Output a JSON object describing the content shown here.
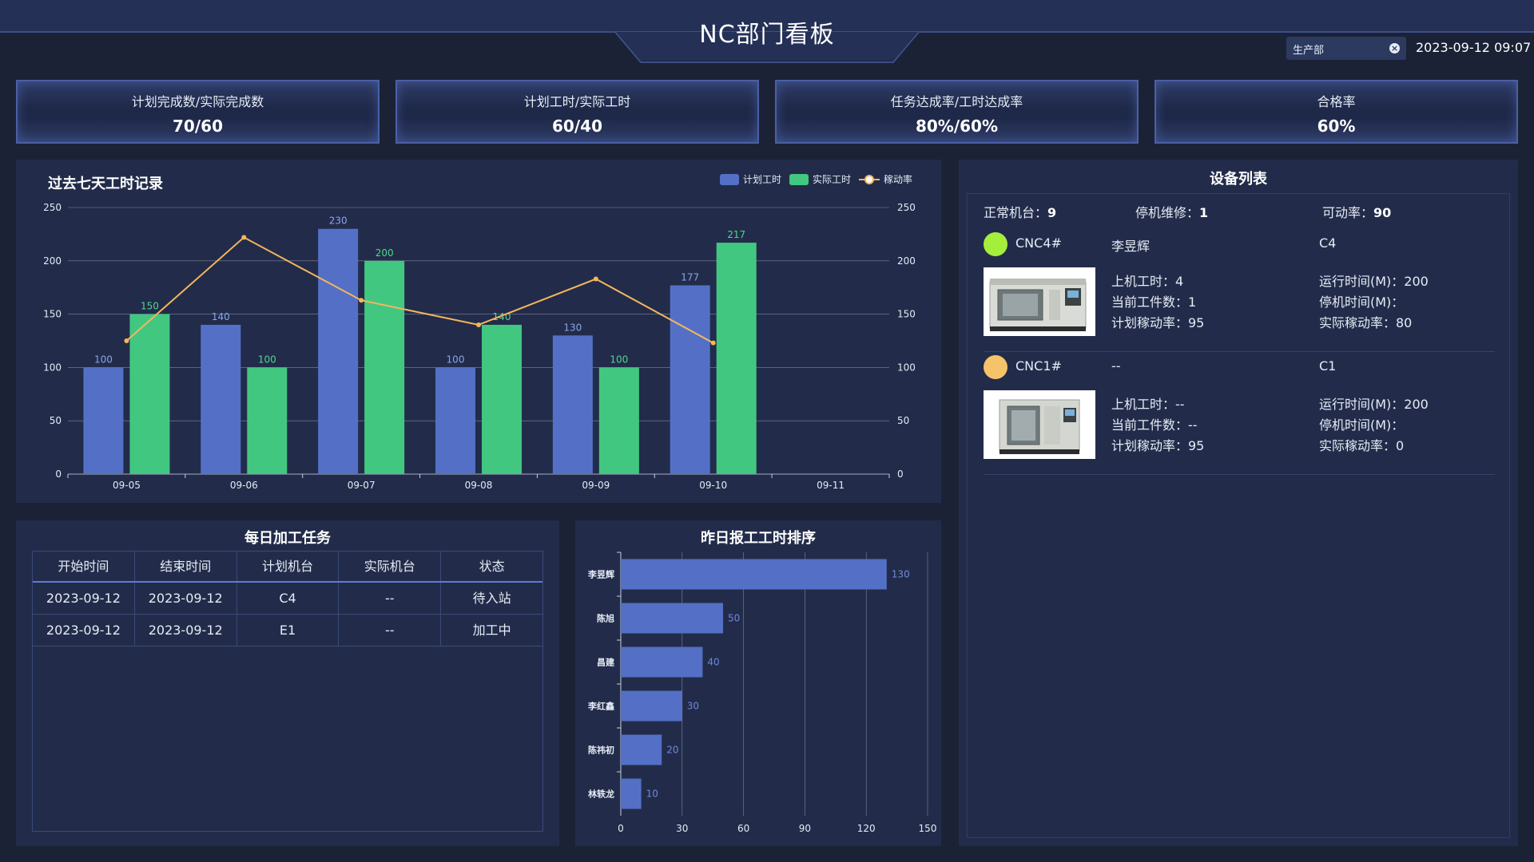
{
  "header": {
    "title": "NC部门看板",
    "department": "生产部",
    "datetime": "2023-09-12 09:07"
  },
  "kpis": [
    {
      "label": "计划完成数/实际完成数",
      "value": "70/60"
    },
    {
      "label": "计划工时/实际工时",
      "value": "60/40"
    },
    {
      "label": "任务达成率/工时达成率",
      "value": "80%/60%"
    },
    {
      "label": "合格率",
      "value": "60%"
    }
  ],
  "work_hours_panel": {
    "title": "过去七天工时记录",
    "legend": {
      "plan": "计划工时",
      "actual": "实际工时",
      "rate": "稼动率"
    }
  },
  "daily_tasks": {
    "title": "每日加工任务",
    "columns": [
      "开始时间",
      "结束时间",
      "计划机台",
      "实际机台",
      "状态"
    ],
    "rows": [
      [
        "2023-09-12",
        "2023-09-12",
        "C4",
        "--",
        "待入站"
      ],
      [
        "2023-09-12",
        "2023-09-12",
        "E1",
        "--",
        "加工中"
      ]
    ]
  },
  "ranking_panel": {
    "title": "昨日报工工时排序"
  },
  "equipment": {
    "title": "设备列表",
    "stats": {
      "normal_label": "正常机台：",
      "normal_value": "9",
      "repair_label": "停机维修：",
      "repair_value": "1",
      "rate_label": "可动率：",
      "rate_value": "90"
    },
    "machines": [
      {
        "name": "CNC4#",
        "operator": "李昱辉",
        "code": "C4",
        "status_color": "#a5ee3c",
        "hours": "上机工时：4",
        "current": "当前工件数：1",
        "plan_rate": "计划稼动率：95",
        "run_time": "运行时间(M)：200",
        "stop_time": "停机时间(M)：",
        "actual_rate": "实际稼动率：80"
      },
      {
        "name": "CNC1#",
        "operator": "--",
        "code": "C1",
        "status_color": "#f5c36a",
        "hours": "上机工时：--",
        "current": "当前工件数：--",
        "plan_rate": "计划稼动率：95",
        "run_time": "运行时间(M)：200",
        "stop_time": "停机时间(M)：",
        "actual_rate": "实际稼动率：0"
      }
    ]
  },
  "colors": {
    "plan": "#5470c6",
    "actual": "#42c781",
    "rate": "#f5b65c",
    "bar_rank": "#5470c6"
  },
  "chart_data": [
    {
      "type": "bar",
      "title": "过去七天工时记录",
      "categories": [
        "09-05",
        "09-06",
        "09-07",
        "09-08",
        "09-09",
        "09-10",
        "09-11"
      ],
      "series": [
        {
          "name": "计划工时",
          "type": "bar",
          "values": [
            100,
            140,
            230,
            100,
            130,
            177,
            null
          ]
        },
        {
          "name": "实际工时",
          "type": "bar",
          "values": [
            150,
            100,
            200,
            140,
            100,
            217,
            null
          ]
        },
        {
          "name": "稼动率",
          "type": "line",
          "values": [
            125,
            222,
            163,
            140,
            183,
            123,
            null
          ]
        }
      ],
      "ylim": [
        0,
        250
      ],
      "yticks": [
        0,
        50,
        100,
        150,
        200,
        250
      ],
      "y2ticks": [
        0,
        50,
        100,
        150,
        200,
        250
      ],
      "grid": true,
      "legend": "top-right"
    },
    {
      "type": "bar",
      "orientation": "horizontal",
      "title": "昨日报工工时排序",
      "categories": [
        "李昱辉",
        "陈旭",
        "昌建",
        "李红鑫",
        "陈祎初",
        "林轶龙"
      ],
      "values": [
        130,
        50,
        40,
        30,
        20,
        10
      ],
      "xlim": [
        0,
        150
      ],
      "xticks": [
        0,
        30,
        60,
        90,
        120,
        150
      ],
      "grid": true
    }
  ]
}
